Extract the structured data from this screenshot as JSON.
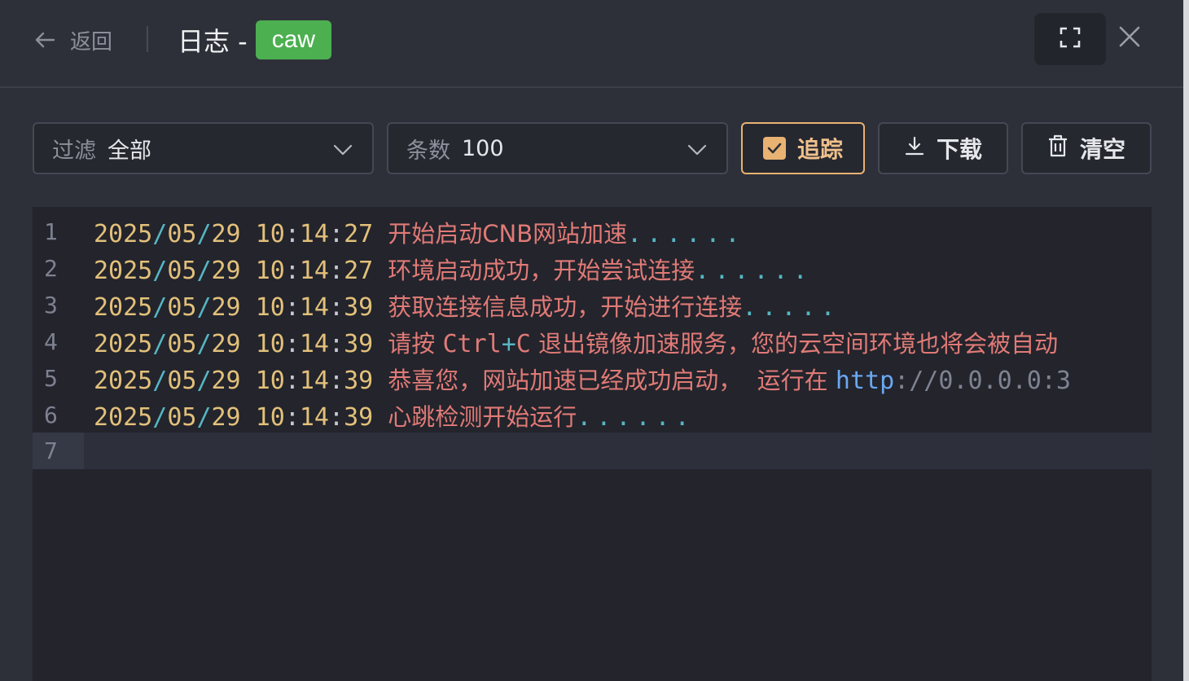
{
  "header": {
    "back_label": "返回",
    "title": "日志 -",
    "badge": "caw",
    "badge_color": "#4caf50"
  },
  "toolbar": {
    "filter": {
      "label": "过滤",
      "value": "全部"
    },
    "count": {
      "label": "条数",
      "value": "100"
    },
    "track_label": "追踪",
    "track_checked": true,
    "download_label": "下载",
    "clear_label": "清空",
    "accent_color": "#e8b273"
  },
  "log": {
    "lines": [
      {
        "n": "1",
        "date": [
          "2025",
          "05",
          "29"
        ],
        "time": [
          "10",
          "14",
          "27"
        ],
        "msg": "开始启动CNB网站加速",
        "dots": "......"
      },
      {
        "n": "2",
        "date": [
          "2025",
          "05",
          "29"
        ],
        "time": [
          "10",
          "14",
          "27"
        ],
        "msg": "环境启动成功，开始尝试连接",
        "dots": "......"
      },
      {
        "n": "3",
        "date": [
          "2025",
          "05",
          "29"
        ],
        "time": [
          "10",
          "14",
          "39"
        ],
        "msg": "获取连接信息成功，开始进行连接",
        "dots": "....."
      },
      {
        "n": "4",
        "date": [
          "2025",
          "05",
          "29"
        ],
        "time": [
          "10",
          "14",
          "39"
        ],
        "msg_a": "请按 ",
        "ctrl": "Ctrl",
        "plus": "+",
        "c": "C",
        "msg_b": " 退出镜像加速服务，您的云空间环境也将会被自动"
      },
      {
        "n": "5",
        "date": [
          "2025",
          "05",
          "29"
        ],
        "time": [
          "10",
          "14",
          "39"
        ],
        "msg": "恭喜您，网站加速已经成功启动，  运行在 ",
        "kw": "http",
        "url": "://0.0.0.0:3"
      },
      {
        "n": "6",
        "date": [
          "2025",
          "05",
          "29"
        ],
        "time": [
          "10",
          "14",
          "39"
        ],
        "msg": "心跳检测开始运行",
        "dots": "......"
      },
      {
        "n": "7"
      }
    ]
  }
}
